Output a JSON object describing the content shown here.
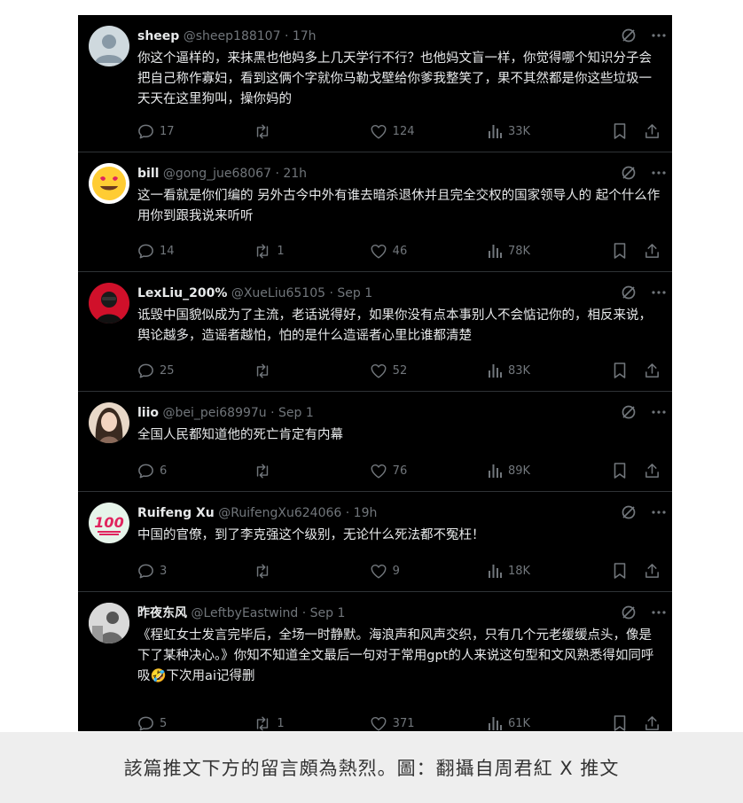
{
  "tweets": [
    {
      "name": "sheep",
      "handle": "@sheep188107",
      "time": "17h",
      "text": "你这个逼样的，来抹黑也他妈多上几天学行不行？也他妈文盲一样，你觉得哪个知识分子会把自己称作寡妇，看到这俩个字就你马勒戈壁给你爹我整笑了，果不其然都是你这些垃圾一天天在这里狗叫，操你妈的",
      "replies": "17",
      "retweets": "",
      "likes": "124",
      "views": "33K",
      "avatar": "default-person"
    },
    {
      "name": "bill",
      "handle": "@gong_jue68067",
      "time": "21h",
      "text": "这一看就是你们编的 另外古今中外有谁去暗杀退休并且完全交权的国家领导人的 起个什么作用你到跟我说来听听",
      "replies": "14",
      "retweets": "1",
      "likes": "46",
      "views": "78K",
      "avatar": "heart-eyes-emoji"
    },
    {
      "name": "LexLiu_200%",
      "handle": "@XueLiu65105",
      "time": "Sep 1",
      "text": "诋毁中国貌似成为了主流，老话说得好，如果你没有点本事别人不会惦记你的，相反来说，舆论越多，造谣者越怕，怕的是什么造谣者心里比谁都清楚",
      "replies": "25",
      "retweets": "",
      "likes": "52",
      "views": "83K",
      "avatar": "red-photo"
    },
    {
      "name": "liio",
      "handle": "@bei_pei68997u",
      "time": "Sep 1",
      "text": "全国人民都知道他的死亡肯定有内幕",
      "replies": "6",
      "retweets": "",
      "likes": "76",
      "views": "89K",
      "avatar": "woman-photo"
    },
    {
      "name": "Ruifeng Xu",
      "handle": "@RuifengXu624066",
      "time": "19h",
      "text": "中国的官僚，到了李克强这个级别，无论什么死法都不冤枉！",
      "replies": "3",
      "retweets": "",
      "likes": "9",
      "views": "18K",
      "avatar": "hundred-emoji"
    },
    {
      "name": "昨夜东风",
      "handle": "@LeftbyEastwind",
      "time": "Sep 1",
      "text": "《程虹女士发言完毕后，全场一时静默。海浪声和风声交织，只有几个元老缓缓点头，像是下了某种决心。》你知不知道全文最后一句对于常用gpt的人来说这句型和文风熟悉得如同呼吸🤣下次用ai记得删",
      "replies": "5",
      "retweets": "1",
      "likes": "371",
      "views": "61K",
      "avatar": "grayscale-photo"
    }
  ],
  "dot": "·",
  "caption": "該篇推文下方的留言頗為熱烈。圖：翻攝自周君紅 X 推文",
  "colors": {
    "background": "#000000",
    "text": "#e7e9ea",
    "muted": "#71767b",
    "divider": "#2f3336"
  },
  "icons": [
    "grok-icon",
    "more-icon",
    "reply-icon",
    "retweet-icon",
    "like-icon",
    "views-icon",
    "bookmark-icon",
    "share-icon"
  ]
}
